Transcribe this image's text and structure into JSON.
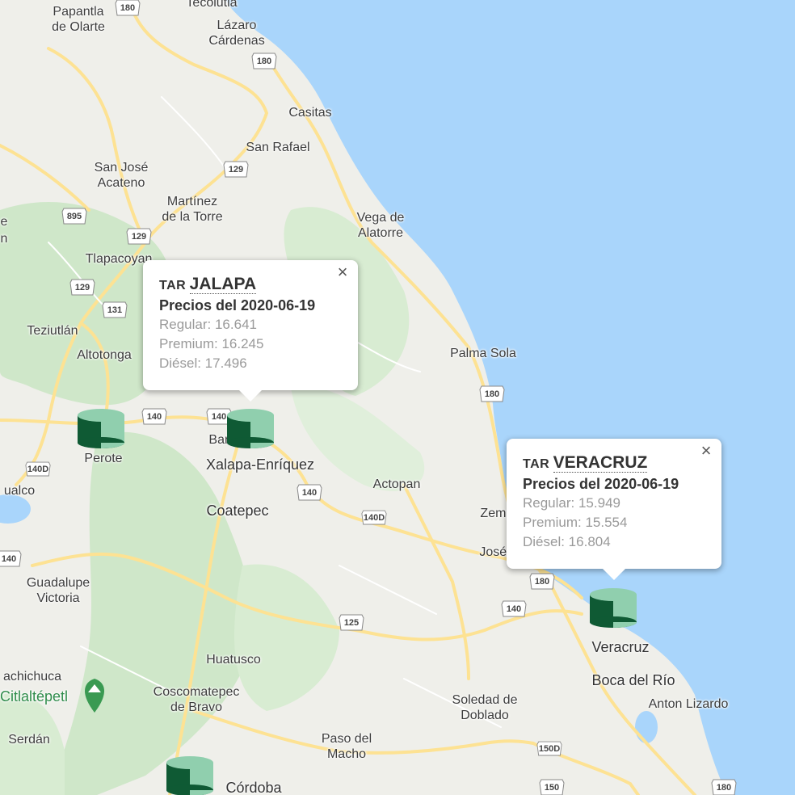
{
  "map": {
    "colors": {
      "land": "#efefea",
      "water": "#a9d5fb",
      "forest": "#cfe7c9",
      "road_major": "#fde293",
      "road_minor": "#ffffff",
      "marker_dark": "#0f5a34",
      "marker_light": "#90cfae",
      "park_icon": "#3a9a52"
    },
    "places": [
      {
        "key": "papantla",
        "text": "Papantla\nde Olarte"
      },
      {
        "key": "tecolutla",
        "text": "Tecolutla"
      },
      {
        "key": "lazaro",
        "text": "Lázaro\nCárdenas"
      },
      {
        "key": "casitas",
        "text": "Casitas"
      },
      {
        "key": "sanrafael",
        "text": "San Rafael"
      },
      {
        "key": "sanjose",
        "text": "San José\nAcateno"
      },
      {
        "key": "martinez",
        "text": "Martínez\nde la Torre"
      },
      {
        "key": "vega",
        "text": "Vega de\nAlatorre"
      },
      {
        "key": "tlapacoyan",
        "text": "Tlapacoyan"
      },
      {
        "key": "teziutlan",
        "text": "Teziutlán"
      },
      {
        "key": "altotonga",
        "text": "Altotonga"
      },
      {
        "key": "palmasola",
        "text": "Palma Sola"
      },
      {
        "key": "perote",
        "text": "Perote"
      },
      {
        "key": "banderilla",
        "text": "Banderilla"
      },
      {
        "key": "xalapa",
        "text": "Xalapa-Enríquez"
      },
      {
        "key": "actopan",
        "text": "Actopan"
      },
      {
        "key": "coatepec",
        "text": "Coatepec"
      },
      {
        "key": "zempoala",
        "text": "Zempoala"
      },
      {
        "key": "josecardel",
        "text": "José Cardel"
      },
      {
        "key": "guadalupe",
        "text": "Guadalupe\nVictoria"
      },
      {
        "key": "huatusco",
        "text": "Huatusco"
      },
      {
        "key": "coscomatepec",
        "text": "Coscomatepec\nde Bravo"
      },
      {
        "key": "chachichuca",
        "text": "achichuca"
      },
      {
        "key": "citlaltepetl",
        "text": "Citlaltépetl"
      },
      {
        "key": "serdan",
        "text": "Serdán"
      },
      {
        "key": "soledad",
        "text": "Soledad de\nDoblado"
      },
      {
        "key": "veracruz",
        "text": "Veracruz"
      },
      {
        "key": "bocadelrio",
        "text": "Boca del Río"
      },
      {
        "key": "antonlizardo",
        "text": "Anton Lizardo"
      },
      {
        "key": "pasodelmacho",
        "text": "Paso del\nMacho"
      },
      {
        "key": "cordoba",
        "text": "Córdoba"
      },
      {
        "key": "gualco",
        "text": "ualco"
      },
      {
        "key": "leftedge1",
        "text": "e"
      },
      {
        "key": "leftedge2",
        "text": "n"
      }
    ],
    "shields": [
      {
        "key": "s180a",
        "text": "180"
      },
      {
        "key": "s180b",
        "text": "180"
      },
      {
        "key": "s129a",
        "text": "129"
      },
      {
        "key": "s895",
        "text": "895"
      },
      {
        "key": "s129b",
        "text": "129"
      },
      {
        "key": "s129c",
        "text": "129"
      },
      {
        "key": "s131",
        "text": "131"
      },
      {
        "key": "s180c",
        "text": "180"
      },
      {
        "key": "s140a",
        "text": "140"
      },
      {
        "key": "s140b",
        "text": "140"
      },
      {
        "key": "s140d",
        "text": "140D"
      },
      {
        "key": "s140c",
        "text": "140"
      },
      {
        "key": "s140d2",
        "text": "140D"
      },
      {
        "key": "s140e",
        "text": "140"
      },
      {
        "key": "s180d",
        "text": "180"
      },
      {
        "key": "s140f",
        "text": "140"
      },
      {
        "key": "s125",
        "text": "125"
      },
      {
        "key": "s150d",
        "text": "150D"
      },
      {
        "key": "s150",
        "text": "150"
      },
      {
        "key": "s180e",
        "text": "180"
      }
    ]
  },
  "popups": {
    "jalapa": {
      "prefix": "TAR",
      "name": "JALAPA",
      "date_label": "Precios del 2020-06-19",
      "regular": "Regular: 16.641",
      "premium": "Premium: 16.245",
      "diesel": "Diésel: 17.496",
      "close": "×"
    },
    "veracruz": {
      "prefix": "TAR",
      "name": "VERACRUZ",
      "date_label": "Precios del 2020-06-19",
      "regular": "Regular: 15.949",
      "premium": "Premium: 15.554",
      "diesel": "Diésel: 16.804",
      "close": "×"
    }
  }
}
